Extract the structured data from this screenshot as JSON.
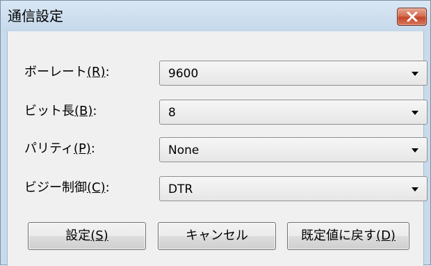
{
  "window": {
    "title": "通信設定",
    "close_label": "×"
  },
  "fields": [
    {
      "label": "ボーレート",
      "mnemonic": "(R)",
      "suffix": ":",
      "value": "9600"
    },
    {
      "label": "ビット長",
      "mnemonic": "(B)",
      "suffix": ":",
      "value": "8"
    },
    {
      "label": "パリティ",
      "mnemonic": "(P)",
      "suffix": ":",
      "value": "None"
    },
    {
      "label": "ビジー制御",
      "mnemonic": "(C)",
      "suffix": ":",
      "value": "DTR"
    }
  ],
  "buttons": {
    "ok_label": "設定",
    "ok_mnemonic": "(S)",
    "cancel_label": "キャンセル",
    "default_label": "既定値に戻す",
    "default_mnemonic": "(D)"
  },
  "icons": {
    "close": "close-icon",
    "dropdown": "chevron-down-icon"
  }
}
